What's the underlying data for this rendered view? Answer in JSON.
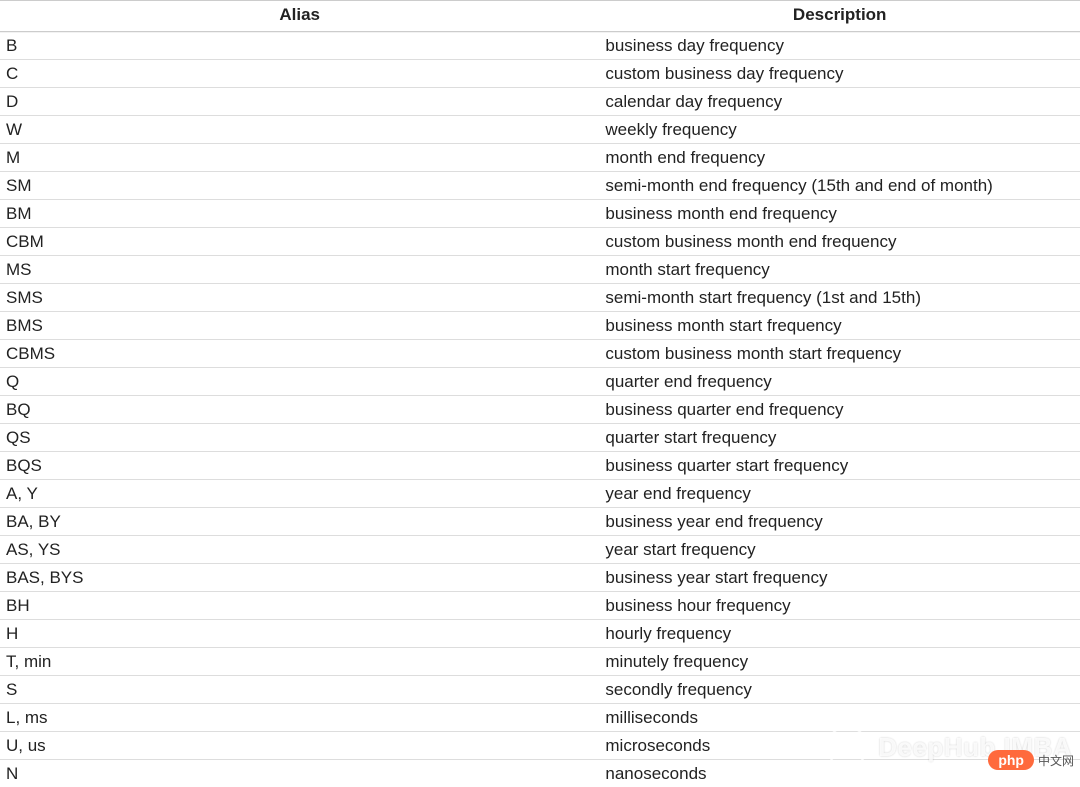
{
  "table": {
    "headers": {
      "alias": "Alias",
      "description": "Description"
    },
    "rows": [
      {
        "alias": "B",
        "description": "business day frequency"
      },
      {
        "alias": "C",
        "description": "custom business day frequency"
      },
      {
        "alias": "D",
        "description": "calendar day frequency"
      },
      {
        "alias": "W",
        "description": "weekly frequency"
      },
      {
        "alias": "M",
        "description": "month end frequency"
      },
      {
        "alias": "SM",
        "description": "semi-month end frequency (15th and end of month)"
      },
      {
        "alias": "BM",
        "description": "business month end frequency"
      },
      {
        "alias": "CBM",
        "description": "custom business month end frequency"
      },
      {
        "alias": "MS",
        "description": "month start frequency"
      },
      {
        "alias": "SMS",
        "description": "semi-month start frequency (1st and 15th)"
      },
      {
        "alias": "BMS",
        "description": "business month start frequency"
      },
      {
        "alias": "CBMS",
        "description": "custom business month start frequency"
      },
      {
        "alias": "Q",
        "description": "quarter end frequency"
      },
      {
        "alias": "BQ",
        "description": "business quarter end frequency"
      },
      {
        "alias": "QS",
        "description": "quarter start frequency"
      },
      {
        "alias": "BQS",
        "description": "business quarter start frequency"
      },
      {
        "alias": "A, Y",
        "description": "year end frequency"
      },
      {
        "alias": "BA, BY",
        "description": "business year end frequency"
      },
      {
        "alias": "AS, YS",
        "description": "year start frequency"
      },
      {
        "alias": "BAS, BYS",
        "description": "business year start frequency"
      },
      {
        "alias": "BH",
        "description": "business hour frequency"
      },
      {
        "alias": "H",
        "description": "hourly frequency"
      },
      {
        "alias": "T, min",
        "description": "minutely frequency"
      },
      {
        "alias": "S",
        "description": "secondly frequency"
      },
      {
        "alias": "L, ms",
        "description": "milliseconds"
      },
      {
        "alias": "U, us",
        "description": "microseconds"
      },
      {
        "alias": "N",
        "description": "nanoseconds"
      }
    ]
  },
  "watermark": {
    "brand": "DeepHub IMBA",
    "badge": "php",
    "badge_cn": "中文网"
  }
}
